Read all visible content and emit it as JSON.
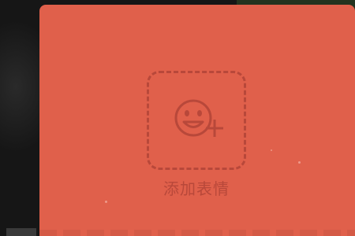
{
  "app": {
    "accent_color": "#e0604b",
    "outline_color": "#b8483a"
  },
  "sticker_panel": {
    "add_sticker_label": "添加表情",
    "add_sticker_icon": "smiley-plus-icon"
  }
}
